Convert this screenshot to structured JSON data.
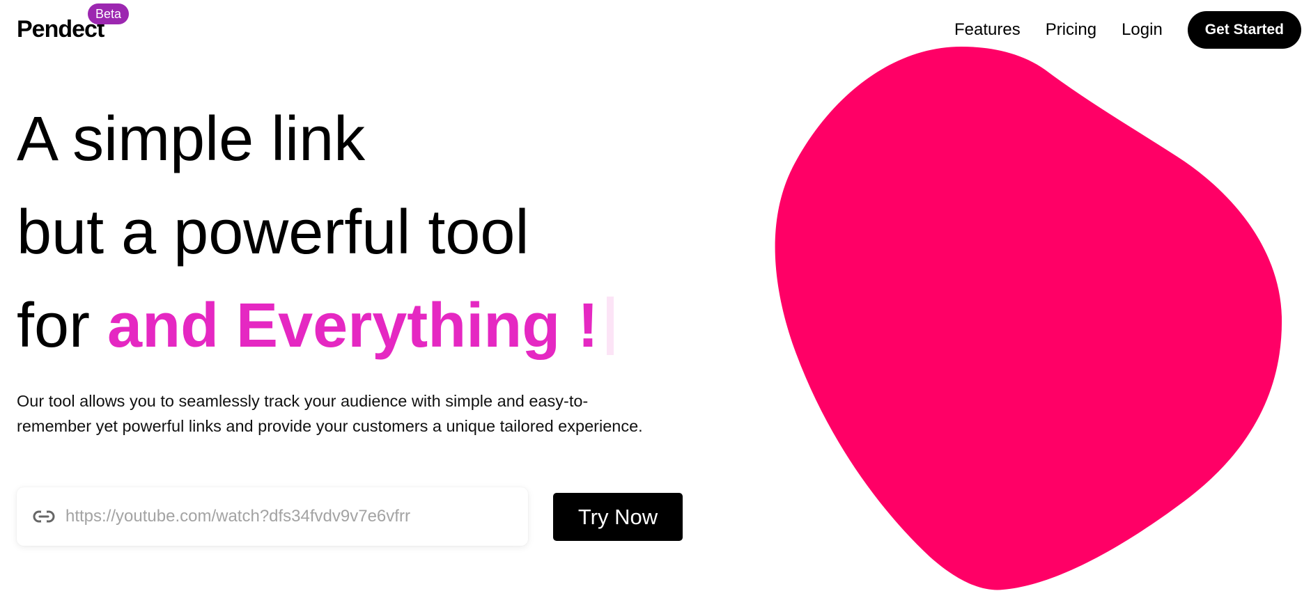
{
  "brand": {
    "name": "Pendect",
    "badge": "Beta"
  },
  "nav": {
    "links": [
      "Features",
      "Pricing",
      "Login"
    ],
    "cta": "Get Started"
  },
  "hero": {
    "line1": "A simple link",
    "line2": "but a powerful tool",
    "line3_prefix": "for ",
    "line3_highlight": "and Everything !",
    "description": "Our tool allows you to seamlessly track your audience with simple and easy-to-remember yet powerful links and provide your customers a unique tailored experience."
  },
  "form": {
    "placeholder": "https://youtube.com/watch?dfs34fvdv9v7e6vfrr",
    "value": "",
    "button": "Try Now",
    "icon": "link-icon"
  },
  "colors": {
    "accent": "#e528c2",
    "badge": "#9c27b0",
    "blob": "#ff0066",
    "button": "#000000"
  }
}
